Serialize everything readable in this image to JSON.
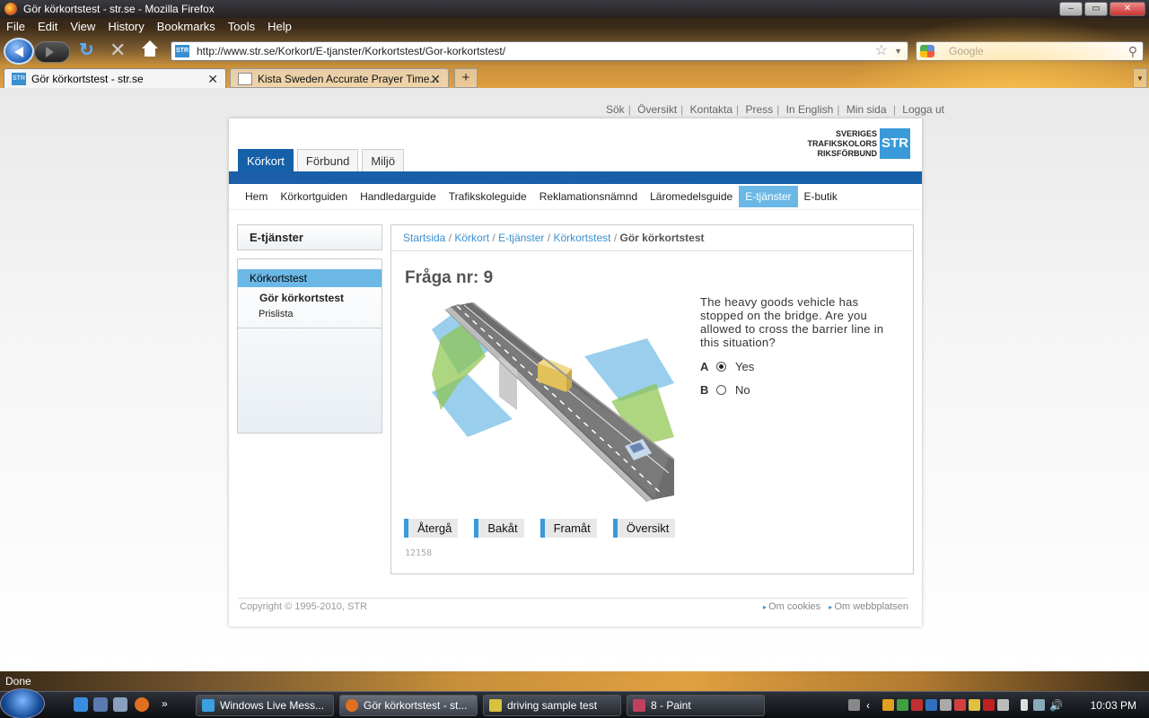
{
  "window": {
    "title": "Gör körkortstest - str.se - Mozilla Firefox"
  },
  "menu": [
    "File",
    "Edit",
    "View",
    "History",
    "Bookmarks",
    "Tools",
    "Help"
  ],
  "url": "http://www.str.se/Korkort/E-tjanster/Korkortstest/Gor-korkortstest/",
  "search_placeholder": "Google",
  "tabs": [
    {
      "label": "Gör körkortstest - str.se",
      "active": true
    },
    {
      "label": "Kista Sweden Accurate Prayer Time...",
      "active": false
    }
  ],
  "site": {
    "toplinks": [
      "Sök",
      "Översikt",
      "Kontakta",
      "Press",
      "In English",
      "Min sida",
      "Logga ut"
    ],
    "logo": {
      "line1": "SVERIGES",
      "line2": "TRAFIKSKOLORS",
      "line3": "RIKSFÖRBUND",
      "mark": "STR"
    },
    "main_tabs": [
      "Körkort",
      "Förbund",
      "Miljö"
    ],
    "subnav": [
      "Hem",
      "Körkortguiden",
      "Handledarguide",
      "Trafikskoleguide",
      "Reklamationsnämnd",
      "Läromedelsguide",
      "E-tjänster",
      "E-butik"
    ],
    "sidebar": {
      "title": "E-tjänster",
      "section": "Körkortstest",
      "items": [
        "Gör körkortstest",
        "Prislista"
      ]
    },
    "breadcrumb": {
      "items": [
        "Startsida",
        "Körkort",
        "E-tjänster",
        "Körkortstest"
      ],
      "current": "Gör körkortstest"
    },
    "question": {
      "title": "Fråga nr: 9",
      "text": "The heavy goods vehicle has stopped on the bridge. Are you allowed to cross the barrier line in this situation?",
      "options": [
        {
          "letter": "A",
          "label": "Yes",
          "selected": true
        },
        {
          "letter": "B",
          "label": "No",
          "selected": false
        }
      ],
      "buttons": [
        "Återgå",
        "Bakåt",
        "Framåt",
        "Översikt"
      ],
      "id": "12158"
    },
    "footer": {
      "copyright": "Copyright © 1995-2010, STR",
      "links": [
        "Om cookies",
        "Om webbplatsen"
      ]
    }
  },
  "status": "Done",
  "taskbar": {
    "tasks": [
      "Windows Live Mess...",
      "Gör körkortstest - st...",
      "driving sample test",
      "8 - Paint"
    ],
    "clock": "10:03 PM"
  }
}
